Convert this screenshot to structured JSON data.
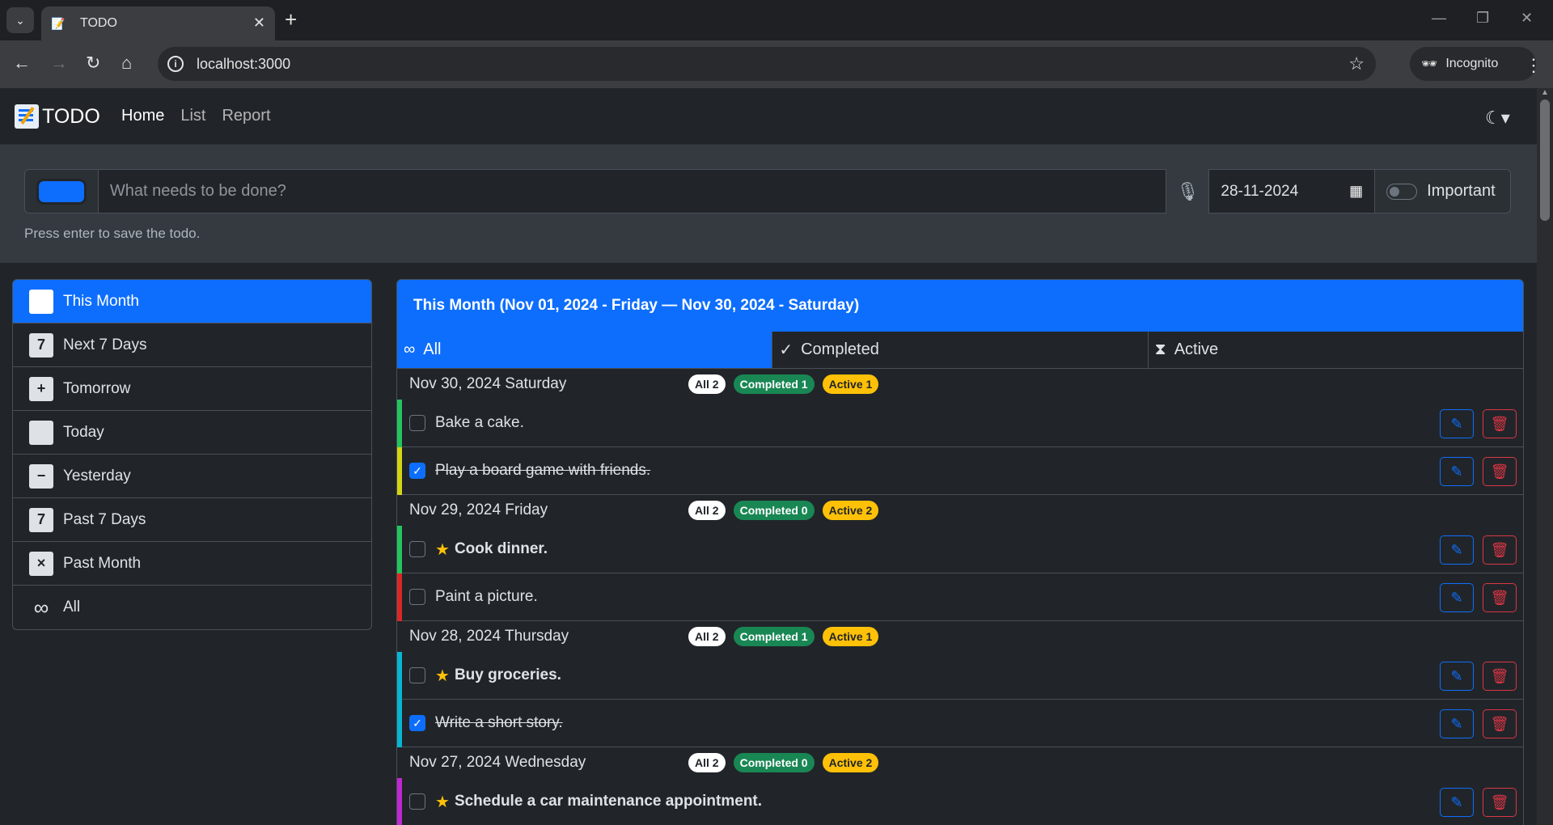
{
  "browser": {
    "tab_title": "TODO",
    "url": "localhost:3000",
    "incognito_label": "Incognito"
  },
  "app": {
    "brand": "TODO",
    "nav": [
      "Home",
      "List",
      "Report"
    ],
    "input_placeholder": "What needs to be done?",
    "color_value": "#0d6efd",
    "date_value": "28-11-2024",
    "important_label": "Important",
    "hint": "Press enter to save the todo."
  },
  "sidebar": {
    "items": [
      {
        "label": "This Month",
        "icon": "calendar-month-icon",
        "glyph": "",
        "active": true
      },
      {
        "label": "Next 7 Days",
        "icon": "calendar-7-icon",
        "glyph": "7"
      },
      {
        "label": "Tomorrow",
        "icon": "calendar-plus-icon",
        "glyph": "+"
      },
      {
        "label": "Today",
        "icon": "calendar-today-icon",
        "glyph": ""
      },
      {
        "label": "Yesterday",
        "icon": "calendar-minus-icon",
        "glyph": "−"
      },
      {
        "label": "Past 7 Days",
        "icon": "calendar-7-icon",
        "glyph": "7"
      },
      {
        "label": "Past Month",
        "icon": "calendar-x-icon",
        "glyph": "×"
      },
      {
        "label": "All",
        "icon": "infinity-icon",
        "glyph": "∞"
      }
    ]
  },
  "main": {
    "title": "This Month (Nov 01, 2024 - Friday — Nov 30, 2024 - Saturday)",
    "filters": [
      {
        "label": "All",
        "icon": "infinity-icon",
        "glyph": "∞",
        "active": true
      },
      {
        "label": "Completed",
        "icon": "check-icon",
        "glyph": "✓"
      },
      {
        "label": "Active",
        "icon": "hourglass-icon",
        "glyph": "⧗"
      }
    ],
    "days": [
      {
        "date": "Nov 30, 2024 Saturday",
        "all": "All 2",
        "completed": "Completed 1",
        "active": "Active 1",
        "todos": [
          {
            "text": "Bake a cake.",
            "done": false,
            "important": false,
            "color": "#22c55e"
          },
          {
            "text": "Play a board game with friends.",
            "done": true,
            "important": false,
            "color": "#d4d413"
          }
        ]
      },
      {
        "date": "Nov 29, 2024 Friday",
        "all": "All 2",
        "completed": "Completed 0",
        "active": "Active 2",
        "todos": [
          {
            "text": "Cook dinner.",
            "done": false,
            "important": true,
            "color": "#22c55e"
          },
          {
            "text": "Paint a picture.",
            "done": false,
            "important": false,
            "color": "#dc2626"
          }
        ]
      },
      {
        "date": "Nov 28, 2024 Thursday",
        "all": "All 2",
        "completed": "Completed 1",
        "active": "Active 1",
        "todos": [
          {
            "text": "Buy groceries.",
            "done": false,
            "important": true,
            "color": "#06b6d4"
          },
          {
            "text": "Write a short story.",
            "done": true,
            "important": false,
            "color": "#06b6d4"
          }
        ]
      },
      {
        "date": "Nov 27, 2024 Wednesday",
        "all": "All 2",
        "completed": "Completed 0",
        "active": "Active 2",
        "todos": [
          {
            "text": "Schedule a car maintenance appointment.",
            "done": false,
            "important": true,
            "color": "#c026d3"
          }
        ]
      }
    ]
  }
}
